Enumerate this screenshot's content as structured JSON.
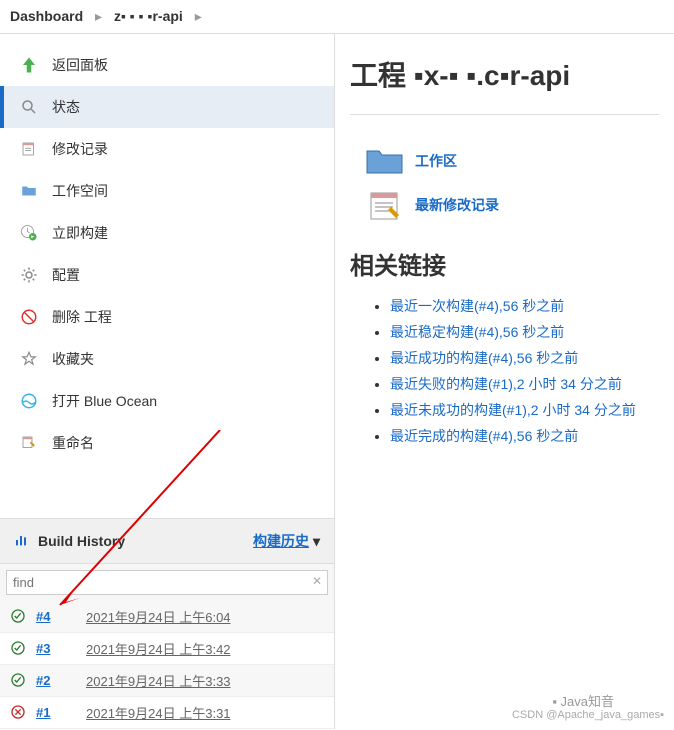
{
  "breadcrumb": {
    "dashboard": "Dashboard",
    "project": "z▪ ▪ ▪ ▪r-api"
  },
  "sidebar": {
    "items": [
      {
        "label": "返回面板"
      },
      {
        "label": "状态"
      },
      {
        "label": "修改记录"
      },
      {
        "label": "工作空间"
      },
      {
        "label": "立即构建"
      },
      {
        "label": "配置"
      },
      {
        "label": "删除 工程"
      },
      {
        "label": "收藏夹"
      },
      {
        "label": "打开 Blue Ocean"
      },
      {
        "label": "重命名"
      }
    ],
    "buildHistory": {
      "title": "Build History",
      "link": "构建历史",
      "findPlaceholder": "find"
    },
    "builds": [
      {
        "num": "#4",
        "time": "2021年9月24日 上午6:04",
        "status": "success"
      },
      {
        "num": "#3",
        "time": "2021年9月24日 上午3:42",
        "status": "success"
      },
      {
        "num": "#2",
        "time": "2021年9月24日 上午3:33",
        "status": "success"
      },
      {
        "num": "#1",
        "time": "2021年9月24日 上午3:31",
        "status": "failed"
      }
    ]
  },
  "main": {
    "title": "工程 ▪x-▪ ▪.c▪r-api",
    "workspace": "工作区",
    "changes": "最新修改记录",
    "relatedTitle": "相关链接",
    "related": [
      "最近一次构建(#4),56 秒之前",
      "最近稳定构建(#4),56 秒之前",
      "最近成功的构建(#4),56 秒之前",
      "最近失败的构建(#1),2 小时 34 分之前",
      "最近未成功的构建(#1),2 小时 34 分之前",
      "最近完成的构建(#4),56 秒之前"
    ]
  },
  "watermark": {
    "top": "▪ Java知音",
    "bottom": "CSDN @Apache_java_games▪"
  }
}
